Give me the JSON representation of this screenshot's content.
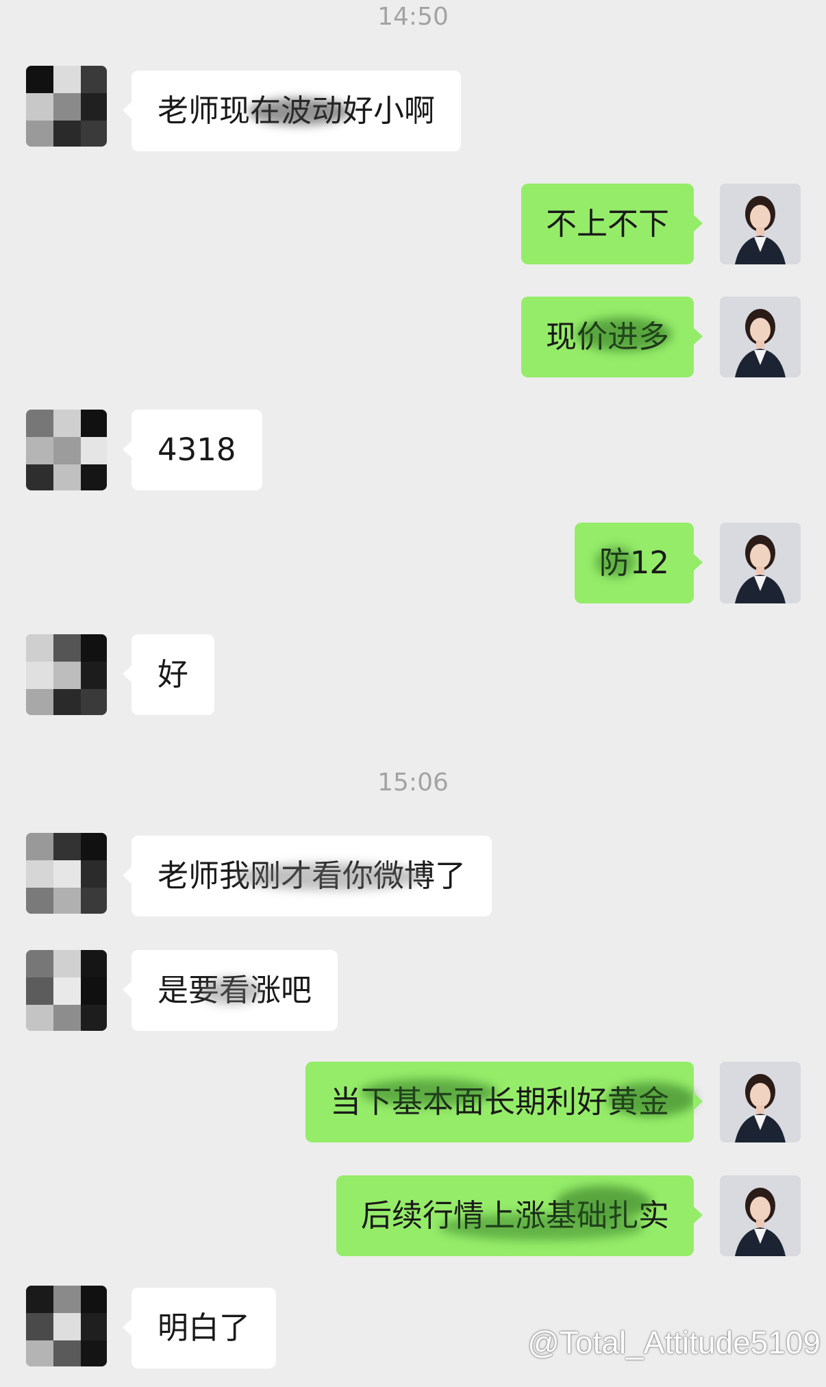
{
  "timestamps": [
    "14:50",
    "15:06"
  ],
  "messages": [
    {
      "sender": "other",
      "text": "老师现在波动好小啊"
    },
    {
      "sender": "self",
      "text": "不上不下"
    },
    {
      "sender": "self",
      "text": "现价进多"
    },
    {
      "sender": "other",
      "text": "4318"
    },
    {
      "sender": "self",
      "text": "防12"
    },
    {
      "sender": "other",
      "text": "好"
    },
    {
      "sender": "other",
      "text": "老师我刚才看你微博了"
    },
    {
      "sender": "other",
      "text": "是要看涨吧"
    },
    {
      "sender": "self",
      "text": "当下基本面长期利好黄金"
    },
    {
      "sender": "self",
      "text": "后续行情上涨基础扎实"
    },
    {
      "sender": "other",
      "text": "明白了"
    }
  ],
  "watermark": "@Total_Attitude5109",
  "colors": {
    "background": "#ededed",
    "self_bubble": "#95ec69",
    "other_bubble": "#ffffff",
    "timestamp": "#a3a3a3"
  }
}
